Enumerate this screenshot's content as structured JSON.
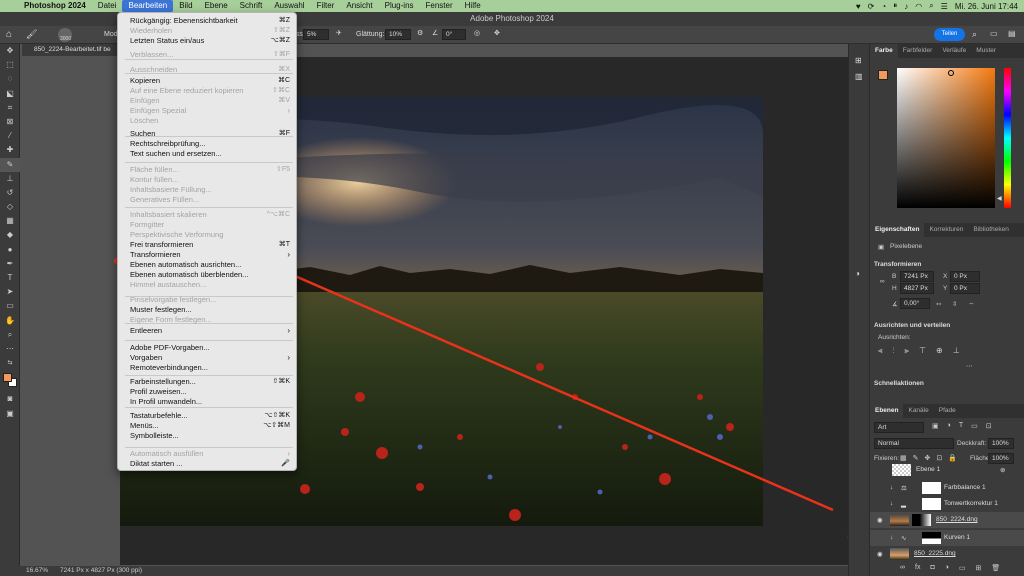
{
  "menubar": {
    "app": "Photoshop 2024",
    "items": [
      "Datei",
      "Bearbeiten",
      "Bild",
      "Ebene",
      "Schrift",
      "Auswahl",
      "Filter",
      "Ansicht",
      "Plug-ins",
      "Fenster",
      "Hilfe"
    ],
    "active": "Bearbeiten",
    "clock": "Mi. 26. Juni  17:44"
  },
  "window_title": "Adobe Photoshop 2024",
  "options": {
    "brush_size": "3000",
    "mode_prefix": "Mod",
    "fluss_label": "Fluss:",
    "fluss": "5%",
    "smoothing_label": "Glättung:",
    "smoothing": "10%",
    "angle": "0°",
    "share": "Teilen"
  },
  "doc_tab": "850_2224-Bearbeitet.tif be",
  "status": {
    "zoom": "16.67%",
    "doc_info": "7241 Px x 4827 Px (300 ppi)"
  },
  "menu": {
    "items": [
      {
        "label": "Rückgängig: Ebenensichtbarkeit",
        "shortcut": "⌘Z",
        "enabled": true
      },
      {
        "label": "Wiederholen",
        "shortcut": "⇧⌘Z",
        "enabled": false
      },
      {
        "label": "Letzten Status ein/aus",
        "shortcut": "⌥⌘Z",
        "enabled": true
      },
      {
        "label": "Verblassen...",
        "shortcut": "⇧⌘F",
        "enabled": false
      },
      {
        "label": "Ausschneiden",
        "shortcut": "⌘X",
        "enabled": false
      },
      {
        "label": "Kopieren",
        "shortcut": "⌘C",
        "enabled": true
      },
      {
        "label": "Auf eine Ebene reduziert kopieren",
        "shortcut": "⇧⌘C",
        "enabled": false
      },
      {
        "label": "Einfügen",
        "shortcut": "⌘V",
        "enabled": false
      },
      {
        "label": "Einfügen Spezial",
        "shortcut": ">",
        "enabled": false
      },
      {
        "label": "Löschen",
        "shortcut": "",
        "enabled": false
      },
      {
        "label": "Suchen",
        "shortcut": "⌘F",
        "enabled": true
      },
      {
        "label": "Rechtschreibprüfung...",
        "shortcut": "",
        "enabled": true
      },
      {
        "label": "Text suchen und ersetzen...",
        "shortcut": "",
        "enabled": true
      },
      {
        "label": "Fläche füllen...",
        "shortcut": "⇧F5",
        "enabled": false
      },
      {
        "label": "Kontur füllen...",
        "shortcut": "",
        "enabled": false
      },
      {
        "label": "Inhaltsbasierte Füllung...",
        "shortcut": "",
        "enabled": false
      },
      {
        "label": "Generatives Füllen...",
        "shortcut": "",
        "enabled": false
      },
      {
        "label": "Inhaltsbasiert skalieren",
        "shortcut": "^⌥⌘C",
        "enabled": false
      },
      {
        "label": "Formgitter",
        "shortcut": "",
        "enabled": false
      },
      {
        "label": "Perspektivische Verformung",
        "shortcut": "",
        "enabled": false
      },
      {
        "label": "Frei transformieren",
        "shortcut": "⌘T",
        "enabled": true
      },
      {
        "label": "Transformieren",
        "shortcut": ">",
        "enabled": true
      },
      {
        "label": "Ebenen automatisch ausrichten...",
        "shortcut": "",
        "enabled": true
      },
      {
        "label": "Ebenen automatisch überblenden...",
        "shortcut": "",
        "enabled": true
      },
      {
        "label": "Himmel austauschen...",
        "shortcut": "",
        "enabled": false
      },
      {
        "label": "Pinselvorgabe festlegen...",
        "shortcut": "",
        "enabled": false
      },
      {
        "label": "Muster festlegen...",
        "shortcut": "",
        "enabled": true
      },
      {
        "label": "Eigene Form festlegen...",
        "shortcut": "",
        "enabled": false
      },
      {
        "label": "Entleeren",
        "shortcut": ">",
        "enabled": true
      },
      {
        "label": "Adobe PDF-Vorgaben...",
        "shortcut": "",
        "enabled": true
      },
      {
        "label": "Vorgaben",
        "shortcut": ">",
        "enabled": true
      },
      {
        "label": "Remoteverbindungen...",
        "shortcut": "",
        "enabled": true
      },
      {
        "label": "Farbeinstellungen...",
        "shortcut": "⇧⌘K",
        "enabled": true
      },
      {
        "label": "Profil zuweisen...",
        "shortcut": "",
        "enabled": true
      },
      {
        "label": "In Profil umwandeln...",
        "shortcut": "",
        "enabled": true
      },
      {
        "label": "Tastaturbefehle...",
        "shortcut": "⌥⇧⌘K",
        "enabled": true
      },
      {
        "label": "Menüs...",
        "shortcut": "⌥⇧⌘M",
        "enabled": true
      },
      {
        "label": "Symbolleiste...",
        "shortcut": "",
        "enabled": true
      },
      {
        "label": "Automatisch ausfüllen",
        "shortcut": ">",
        "enabled": false
      },
      {
        "label": "Diktat starten ...",
        "shortcut": "🎤",
        "enabled": true
      }
    ]
  },
  "color_panel": {
    "tabs": [
      "Farbe",
      "Farbfelder",
      "Verläufe",
      "Muster"
    ],
    "fg": "#f29a5a",
    "bg": "#ffffff",
    "hue": "#f57a10"
  },
  "properties": {
    "tabs": [
      "Eigenschaften",
      "Korrekturen",
      "Bibliotheken"
    ],
    "kind": "Pixelebene",
    "transform_title": "Transformieren",
    "w_label": "B",
    "w": "7241 Px",
    "x_label": "X",
    "x": "0 Px",
    "h_label": "H",
    "h": "4827 Px",
    "y_label": "Y",
    "y": "0 Px",
    "angle": "0,00°",
    "align_title": "Ausrichten und verteilen",
    "align_label": "Ausrichten:",
    "quick_title": "Schnellaktionen"
  },
  "layers": {
    "tabs": [
      "Ebenen",
      "Kanäle",
      "Pfade"
    ],
    "filter": "Art",
    "blend": "Normal",
    "opacity_label": "Deckkraft:",
    "opacity": "100%",
    "lock_label": "Fixieren:",
    "fill_label": "Fläche:",
    "fill": "100%",
    "items": [
      {
        "name": "Ebene 1"
      },
      {
        "name": "Farbbalance 1"
      },
      {
        "name": "Tonwertkorrektur 1"
      },
      {
        "name": "850_2224.dng"
      },
      {
        "name": "Kurven 1"
      },
      {
        "name": "850_2225.dng"
      }
    ]
  },
  "annotation_color": "#e8321a"
}
